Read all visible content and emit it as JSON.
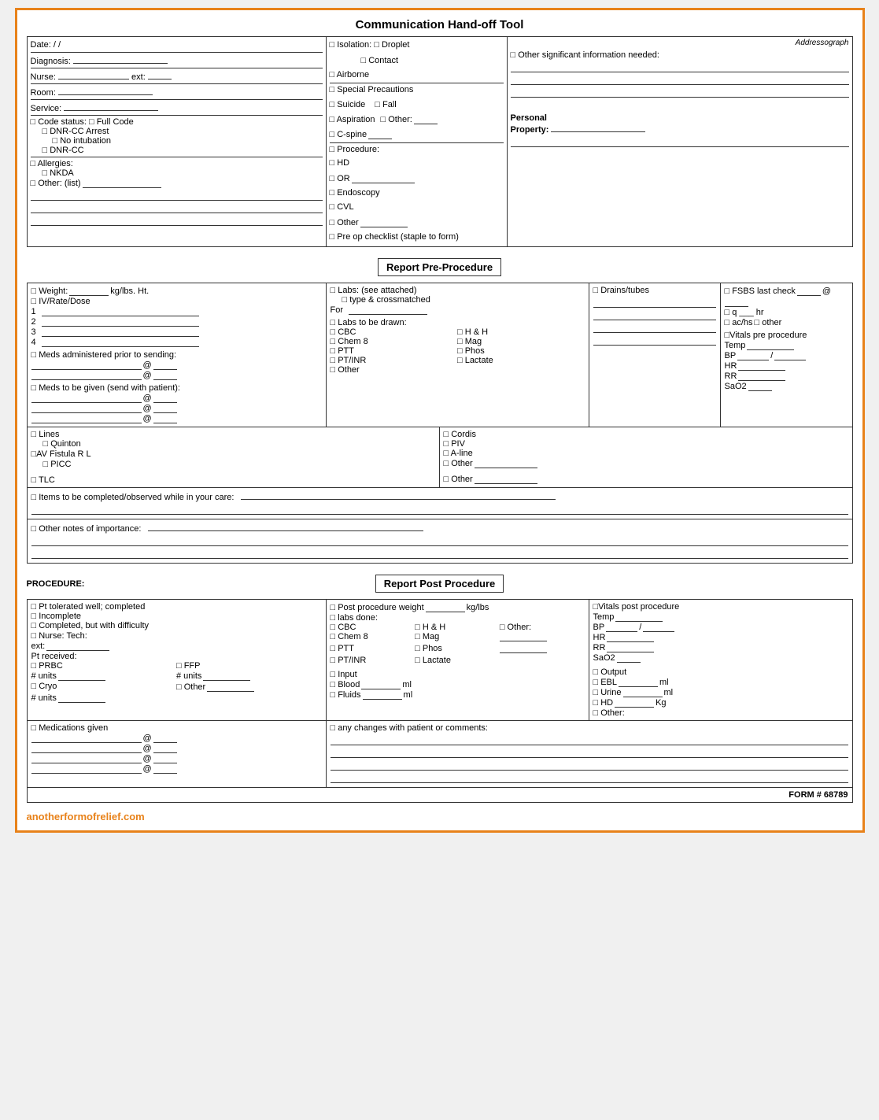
{
  "title": "Communication Hand-off Tool",
  "top_left": {
    "date_label": "Date:",
    "date_slashes": "/ /",
    "diagnosis_label": "Diagnosis:",
    "nurse_label": "Nurse:",
    "ext_label": "ext:",
    "room_label": "Room:",
    "service_label": "Service:",
    "code_status": "□ Code status: □ Full Code",
    "dnrcc_arrest": "□ DNR-CC Arrest",
    "no_intubation": "□ No intubation",
    "dnrcc": "□ DNR-CC",
    "allergies": "□ Allergies:",
    "nkda": "□ NKDA",
    "other_list": "□ Other: (list)"
  },
  "top_middle": {
    "isolation": "□ Isolation:  □ Droplet",
    "contact": "□ Contact",
    "airborne": "□ Airborne",
    "special_precautions": "□ Special Precautions",
    "suicide": "□ Suicide",
    "fall": "□ Fall",
    "aspiration": "□ Aspiration",
    "other_sp": "□ Other:",
    "cspine": "□ C-spine",
    "procedure": "□ Procedure:",
    "hd": "□ HD",
    "or": "□ OR",
    "endoscopy": "□ Endoscopy",
    "cvl": "□ CVL",
    "other_proc": "□ Other",
    "pre_op": "□ Pre op checklist (staple to form)"
  },
  "top_right": {
    "addressograph": "Addressograph",
    "other_info": "□ Other significant information needed:",
    "personal_property": "Personal Property:"
  },
  "pre_procedure": {
    "header": "Report Pre-Procedure",
    "weight_label": "□ Weight:",
    "kg_lbs_ht": "kg/lbs.  Ht.",
    "iv_rate_dose": "□ IV/Rate/Dose",
    "lines": [
      "1",
      "2",
      "3",
      "4"
    ],
    "meds_prior": "□ Meds administered prior to sending:",
    "meds_at1": "@",
    "meds_at2": "@",
    "meds_send": "□ Meds to be given (send with patient):",
    "meds_send_at1": "@",
    "meds_send_at2": "@",
    "meds_send_at3": "@",
    "labs_see_attached": "□ Labs: (see attached)",
    "type_crossmatched": "□ type & crossmatched",
    "for_label": "For",
    "labs_drawn": "□ Labs to be drawn:",
    "cbc": "□ CBC",
    "hh": "□ H & H",
    "chem8": "□ Chem 8",
    "mag": "□ Mag",
    "ptt": "□ PTT",
    "phos": "□ Phos",
    "ptinr": "□ PT/INR",
    "lactate": "□ Lactate",
    "other_labs": "□ Other",
    "drains_tubes": "□ Drains/tubes",
    "fsbs": "□ FSBS last check",
    "at_symbol": "@",
    "q_hr": "□ q ___ hr",
    "achs": "□ ac/hs",
    "other_fsbs": "□ other",
    "vitals_pre": "□Vitals pre procedure",
    "temp_pre": "Temp",
    "bp_pre": "BP",
    "bp_slash": "/",
    "hr_pre": "HR",
    "rr_pre": "RR",
    "sao2_pre": "SaO2",
    "lines_section": "□ Lines",
    "quinton": "□ Quinton",
    "av_fistula": "□AV Fistula  R   L",
    "picc": "□ PICC",
    "tlc": "□ TLC",
    "cordis": "□ Cordis",
    "piv": "□ PIV",
    "aline": "□ A-line",
    "other_lines": "□ Other",
    "other_lines2": "□ Other",
    "items_completed": "□ Items to be completed/observed while in your care:",
    "other_notes": "□ Other notes of importance:"
  },
  "post_procedure": {
    "procedure_label": "PROCEDURE:",
    "header": "Report Post Procedure",
    "pt_tolerated": "□ Pt tolerated well; completed",
    "incomplete": "□ Incomplete",
    "completed_difficulty": "□ Completed, but with difficulty",
    "nurse_tech": "□ Nurse: Tech:",
    "ext": "ext:",
    "pt_received": "Pt received:",
    "prbc": "□ PRBC",
    "ffp": "□ FFP",
    "units_prbc": "# units",
    "units_ffp": "# units",
    "cryo": "□ Cryo",
    "other_blood": "□ Other",
    "units_cryo": "# units",
    "post_weight": "□ Post procedure weight",
    "kg_lbs": "kg/lbs",
    "labs_done": "□ labs done:",
    "cbc_post": "□ CBC",
    "hh_post": "□ H & H",
    "other_post": "□ Other:",
    "chem8_post": "□ Chem 8",
    "mag_post": "□ Mag",
    "ptt_post": "□ PTT",
    "phos_post": "□ Phos",
    "ptinr_post": "□ PT/INR",
    "lactate_post": "□ Lactate",
    "input": "□ Input",
    "blood": "□ Blood",
    "ml_blood": "ml",
    "fluids": "□ Fluids",
    "ml_fluids": "ml",
    "vitals_post": "□Vitals post procedure",
    "temp_post": "Temp",
    "bp_post": "BP",
    "bp_slash_post": "/",
    "hr_post": "HR",
    "rr_post": "RR",
    "sao2_post": "SaO2",
    "output": "□ Output",
    "ebl": "□ EBL",
    "ml_ebl": "ml",
    "urine": "□ Urine",
    "ml_urine": "ml",
    "hd": "□ HD",
    "kg_hd": "Kg",
    "other_output": "□ Other:",
    "meds_given": "□ Medications given",
    "meds_at1": "@",
    "meds_at2": "@",
    "meds_at3": "@",
    "meds_at4": "@",
    "any_changes": "□ any changes with patient or comments:",
    "form_number": "FORM # 68789"
  },
  "footer": {
    "website": "anotherformofrelief.com"
  }
}
